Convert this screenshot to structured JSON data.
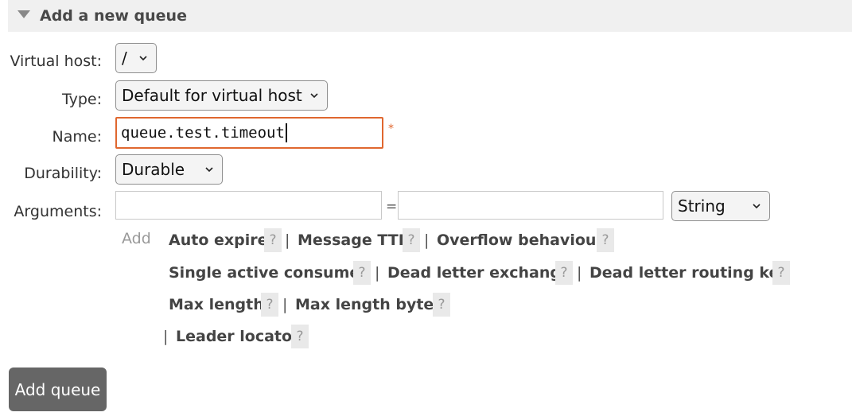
{
  "section": {
    "title": "Add a new queue"
  },
  "form": {
    "virtual_host": {
      "label": "Virtual host:",
      "value": "/"
    },
    "type": {
      "label": "Type:",
      "value": "Default for virtual host"
    },
    "name": {
      "label": "Name:",
      "value": "queue.test.timeout",
      "required_marker": "*"
    },
    "durability": {
      "label": "Durability:",
      "value": "Durable"
    },
    "arguments": {
      "label": "Arguments:",
      "key_value": "",
      "equals": "=",
      "value_value": "",
      "type_value": "String"
    }
  },
  "add_helpers": {
    "add_label": "Add",
    "help_symbol": "?",
    "separator": "|",
    "items": [
      "Auto expire",
      "Message TTL",
      "Overflow behaviour",
      "Single active consumer",
      "Dead letter exchange",
      "Dead letter routing key",
      "Max length",
      "Max length bytes",
      "Leader locator"
    ]
  },
  "buttons": {
    "add_queue": "Add queue"
  },
  "colors": {
    "accent": "#e0672f",
    "button_bg": "#666666",
    "header_bg": "#f0f0f0"
  },
  "icons": {
    "collapse": "triangle-down-icon",
    "dropdown": "chevron-down-icon"
  }
}
